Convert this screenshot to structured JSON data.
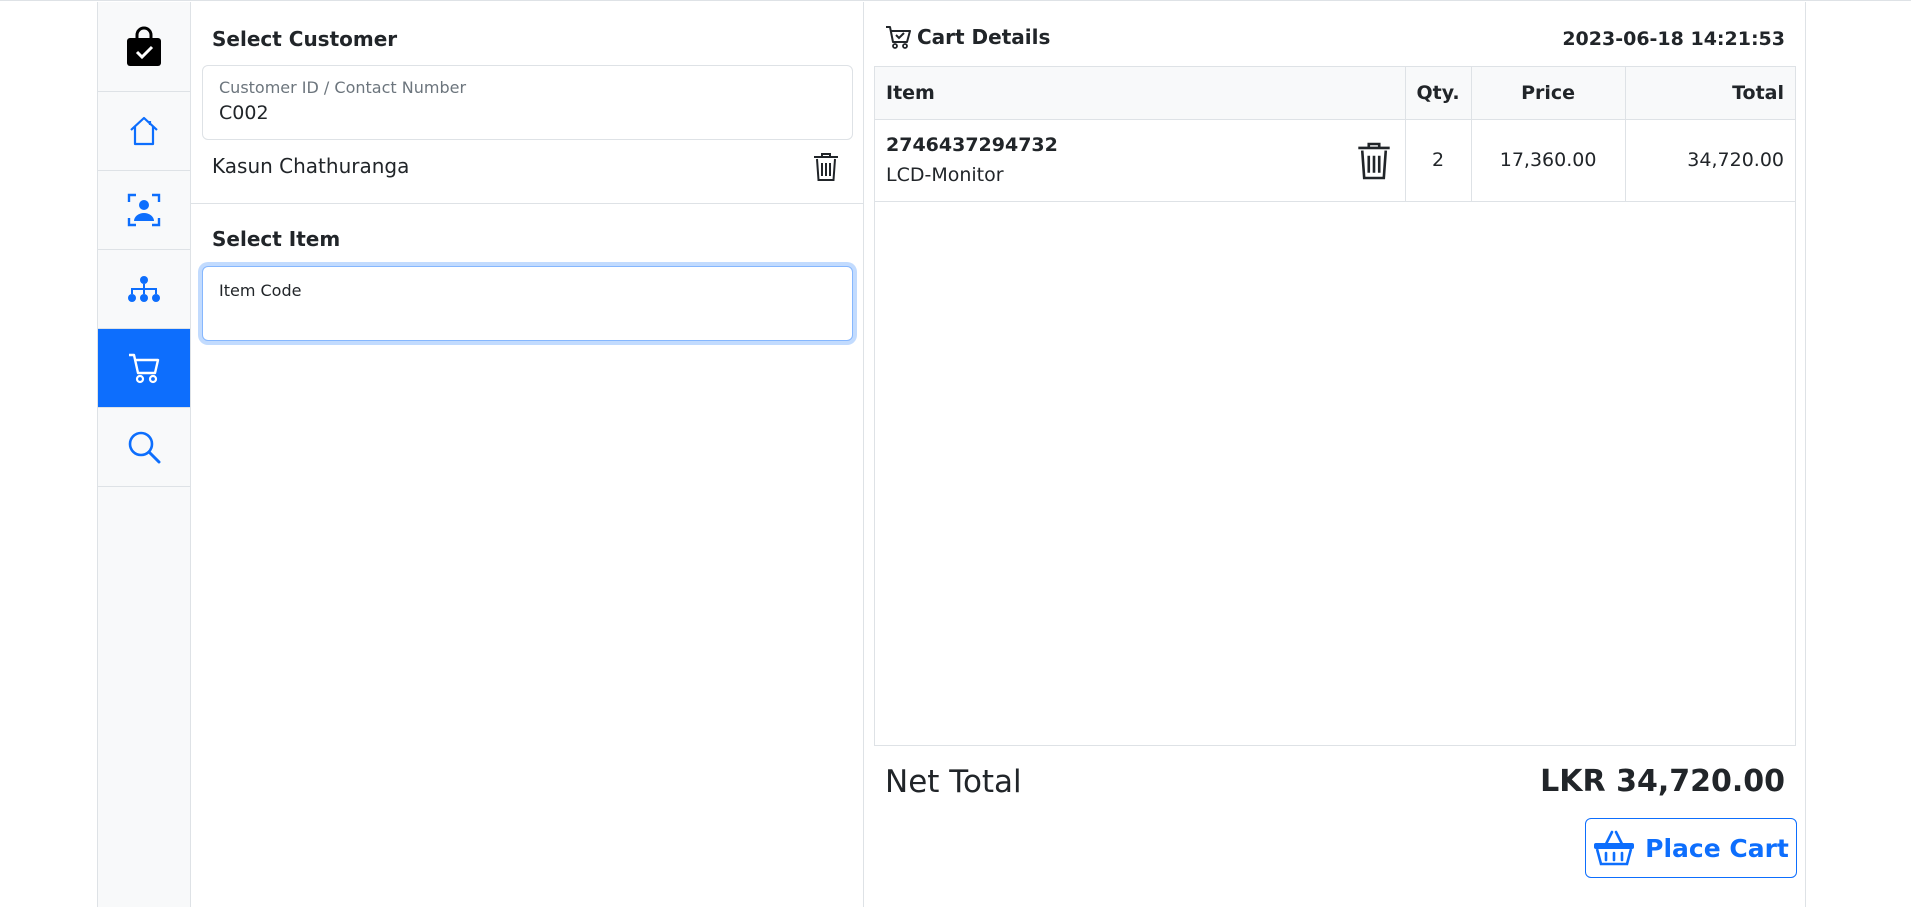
{
  "sidebar": {
    "items": [
      {
        "icon": "shopping-bag-check-icon"
      },
      {
        "icon": "house-icon"
      },
      {
        "icon": "person-badge-icon"
      },
      {
        "icon": "diagram-icon"
      },
      {
        "icon": "cart-icon"
      },
      {
        "icon": "search-icon"
      }
    ],
    "active_color": "#0d6efd"
  },
  "customer": {
    "section_title": "Select Customer",
    "field_label": "Customer ID / Contact Number",
    "field_value": "C002",
    "name": "Kasun Chathuranga"
  },
  "item_select": {
    "section_title": "Select Item",
    "field_label": "Item Code"
  },
  "cart": {
    "title": "Cart Details",
    "datetime": "2023-06-18 14:21:53",
    "columns": [
      "Item",
      "Qty.",
      "Price",
      "Total"
    ],
    "rows": [
      {
        "code": "2746437294732",
        "name": "LCD-Monitor",
        "qty": "2",
        "price": "17,360.00",
        "total": "34,720.00"
      }
    ],
    "net_total_label": "Net Total",
    "net_total_value": "LKR 34,720.00",
    "place_button": "Place Cart"
  }
}
